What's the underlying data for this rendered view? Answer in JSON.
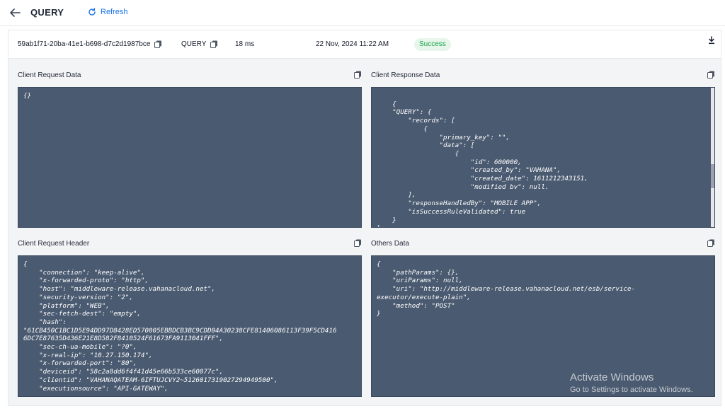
{
  "header": {
    "title": "QUERY",
    "refresh_label": "Refresh"
  },
  "info": {
    "request_id": "59ab1f71-20ba-41e1-b698-d7c2d1987bce",
    "type": "QUERY",
    "duration": "18 ms",
    "timestamp": "22 Nov, 2024 11:22 AM",
    "status": "Success"
  },
  "colors": {
    "accent": "#1a73e8",
    "code_bg": "#4a5a70",
    "success": "#16a34a"
  },
  "panels": {
    "client_request_data": {
      "label": "Client Request Data",
      "content": "{}"
    },
    "client_response_data": {
      "label": "Client Response Data",
      "content": "{\n    \"QUERY\": {\n        \"records\": [\n            {\n                \"primary_key\": \"\",\n                \"data\": [\n                    {\n                        \"id\": 600000,\n                        \"created_by\": \"VAHANA\",\n                        \"created_date\": 1611212343151,\n                        \"modified bv\": null.\n        ],\n        \"responseHandledBy\": \"MOBILE APP\",\n        \"isSuccessRuleValidated\": true\n    }\n}"
    },
    "client_request_header": {
      "label": "Client Request Header",
      "content": "{\n    \"connection\": \"keep-alive\",\n    \"x-forwarded-proto\": \"http\",\n    \"host\": \"middleware-release.vahanacloud.net\",\n    \"security-version\": \"2\",\n    \"platform\": \"WEB\",\n    \"sec-fetch-dest\": \"empty\",\n    \"hash\":\n\"61CB450C1BC1D5E94DD97D8428ED570005EBBDCB3BC9CDD04A30238CFE81406086113F39F5CD416\n6DC7E87635D436E21E8D582F8410524F61673FA9113041FFF\",\n    \"sec-ch-ua-mobile\": \"?0\",\n    \"x-real-ip\": \"10.27.150.174\",\n    \"x-forwarded-port\": \"80\",\n    \"deviceid\": \"58c2a8dd6f4f41d45e66b533ce60077c\",\n    \"clientid\": \"VAHANAQATEAM-6IFTUJCVY2~5126017319027294949500\",\n    \"executionsource\": \"API-GATEWAY\","
    },
    "others_data": {
      "label": "Others Data",
      "content": "{\n    \"pathParams\": {},\n    \"uriParams\": null,\n    \"uri\": \"http://middleware-release.vahanacloud.net/esb/service-\nexecutor/execute-plain\",\n    \"method\": \"POST\"\n}"
    }
  },
  "watermark": {
    "line1": "Activate Windows",
    "line2": "Go to Settings to activate Windows."
  }
}
